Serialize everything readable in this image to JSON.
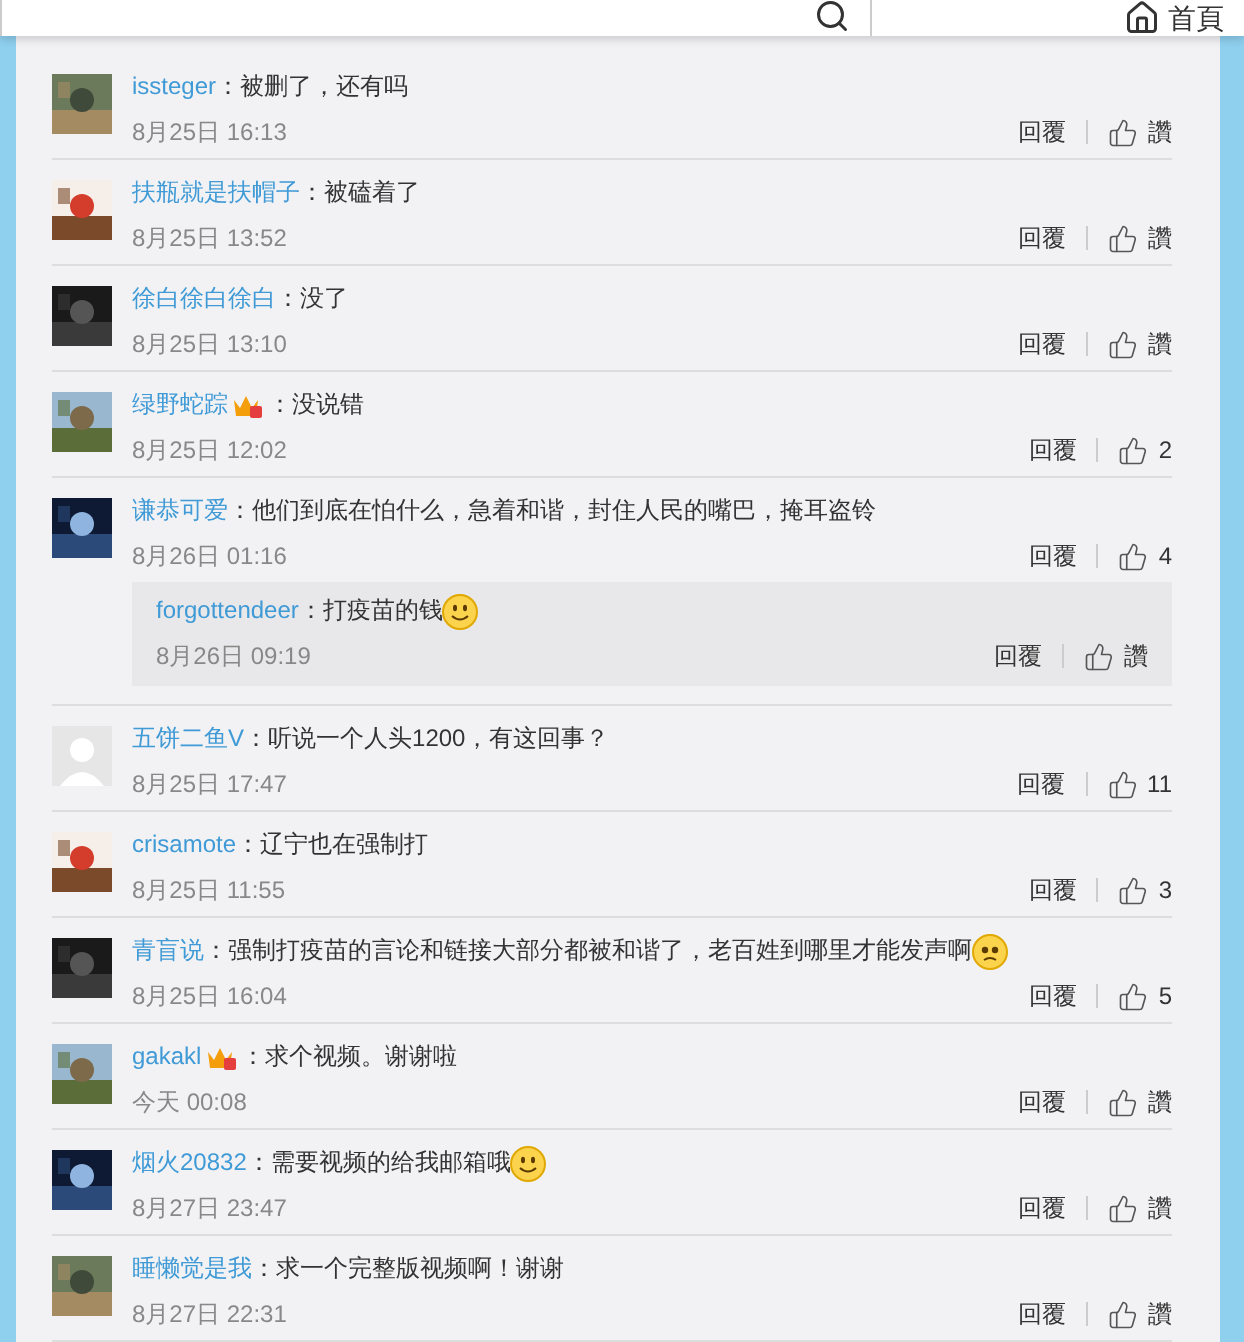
{
  "header": {
    "home_link": "首頁"
  },
  "comments": [
    {
      "name": "issteger",
      "vip": false,
      "text": "：被删了，还有吗",
      "time": "8月25日 16:13",
      "reply": "回覆",
      "likes": "讚"
    },
    {
      "name": "扶瓶就是扶帽子",
      "vip": false,
      "text": "：被磕着了",
      "time": "8月25日 13:52",
      "reply": "回覆",
      "likes": "讚"
    },
    {
      "name": "徐白徐白徐白",
      "vip": false,
      "text": "：没了",
      "time": "8月25日 13:10",
      "reply": "回覆",
      "likes": "讚"
    },
    {
      "name": "绿野蛇踪",
      "vip": true,
      "text": "：没说错",
      "time": "8月25日 12:02",
      "reply": "回覆",
      "likes": "2"
    },
    {
      "name": "谦恭可爱",
      "vip": false,
      "text": "：他们到底在怕什么，急着和谐，封住人民的嘴巴，掩耳盗铃",
      "time": "8月26日 01:16",
      "reply": "回覆",
      "likes": "4",
      "replies": [
        {
          "name": "forgottendeer",
          "text": "：打疫苗的钱",
          "emoji": {
            "kind": "smile"
          },
          "time": "8月26日 09:19",
          "reply": "回覆",
          "likes": "讚"
        }
      ]
    },
    {
      "avatar": {
        "kind": "default"
      },
      "name": "五饼二鱼V",
      "vip": false,
      "text": "：听说一个人头1200，有这回事？",
      "time": "8月25日 17:47",
      "reply": "回覆",
      "likes": "11"
    },
    {
      "name": "crisamote",
      "vip": false,
      "text": "：辽宁也在强制打",
      "time": "8月25日 11:55",
      "reply": "回覆",
      "likes": "3"
    },
    {
      "name": "青盲说",
      "vip": false,
      "text": "：强制打疫苗的言论和链接大部分都被和谐了，老百姓到哪里才能发声啊",
      "emoji": {
        "kind": "sad"
      },
      "time": "8月25日 16:04",
      "reply": "回覆",
      "likes": "5"
    },
    {
      "name": "gakakl",
      "vip": true,
      "text": "：求个视频。谢谢啦",
      "time": "今天 00:08",
      "reply": "回覆",
      "likes": "讚"
    },
    {
      "name": "烟火20832",
      "vip": false,
      "text": "：需要视频的给我邮箱哦",
      "emoji": {
        "kind": "smile"
      },
      "time": "8月27日 23:47",
      "reply": "回覆",
      "likes": "讚"
    },
    {
      "name": "睡懒觉是我",
      "vip": false,
      "text": "：求一个完整版视频啊！谢谢",
      "time": "8月27日 22:31",
      "reply": "回覆",
      "likes": "讚"
    }
  ]
}
